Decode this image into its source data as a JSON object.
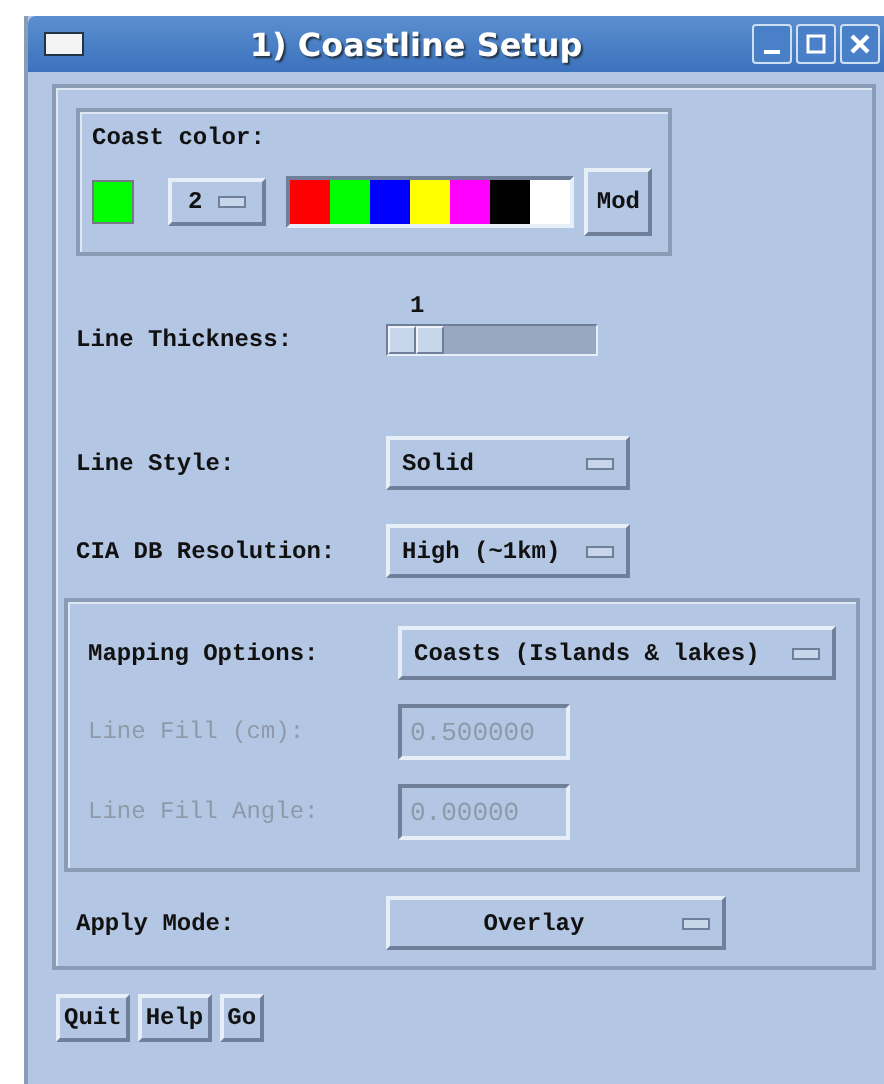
{
  "window": {
    "title": "1) Coastline Setup"
  },
  "coast_color": {
    "label": "Coast color:",
    "current_swatch": {
      "color": "#00ff00"
    },
    "index_menu": "2",
    "palette": [
      {
        "color": "#ff0000"
      },
      {
        "color": "#00ff00"
      },
      {
        "color": "#0000ff"
      },
      {
        "color": "#ffff00"
      },
      {
        "color": "#ff00ff"
      },
      {
        "color": "#000000"
      },
      {
        "color": "#ffffff"
      }
    ],
    "mod_button": "Mod"
  },
  "line_thickness": {
    "label": "Line Thickness:",
    "reading": "1",
    "level": 0.27
  },
  "line_style": {
    "label": "Line Style:",
    "value": "Solid"
  },
  "resolution": {
    "label": "CIA DB Resolution:",
    "value": "High (~1km)"
  },
  "mapping": {
    "label": "Mapping Options:",
    "value": "Coasts (Islands & lakes)",
    "fields": [
      {
        "label": "Line Fill (cm):",
        "value": "0.500000",
        "disabled": true
      },
      {
        "label": "Line Fill Angle:",
        "value": "0.00000",
        "disabled": true
      }
    ]
  },
  "apply_mode": {
    "label": "Apply Mode:",
    "value": "Overlay"
  },
  "buttons": [
    "Quit",
    "Help",
    "Go"
  ]
}
